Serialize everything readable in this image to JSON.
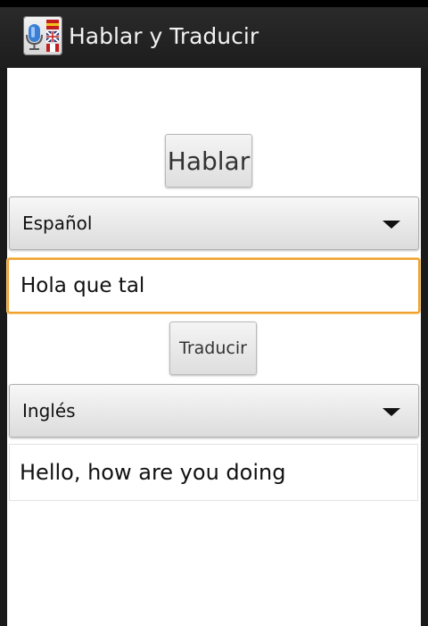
{
  "app": {
    "title": "Hablar y Traducir",
    "icon": "microphone-flags-icon"
  },
  "speak_button": {
    "label": "Hablar"
  },
  "source_language": {
    "selected": "Español"
  },
  "input": {
    "value": "Hola que tal"
  },
  "translate_button": {
    "label": "Traducir"
  },
  "target_language": {
    "selected": "Inglés"
  },
  "output": {
    "text": "Hello, how are you doing"
  },
  "colors": {
    "focus_border": "#f0a030",
    "title_bar": "#1d1d1d",
    "content_bg": "#ffffff"
  }
}
